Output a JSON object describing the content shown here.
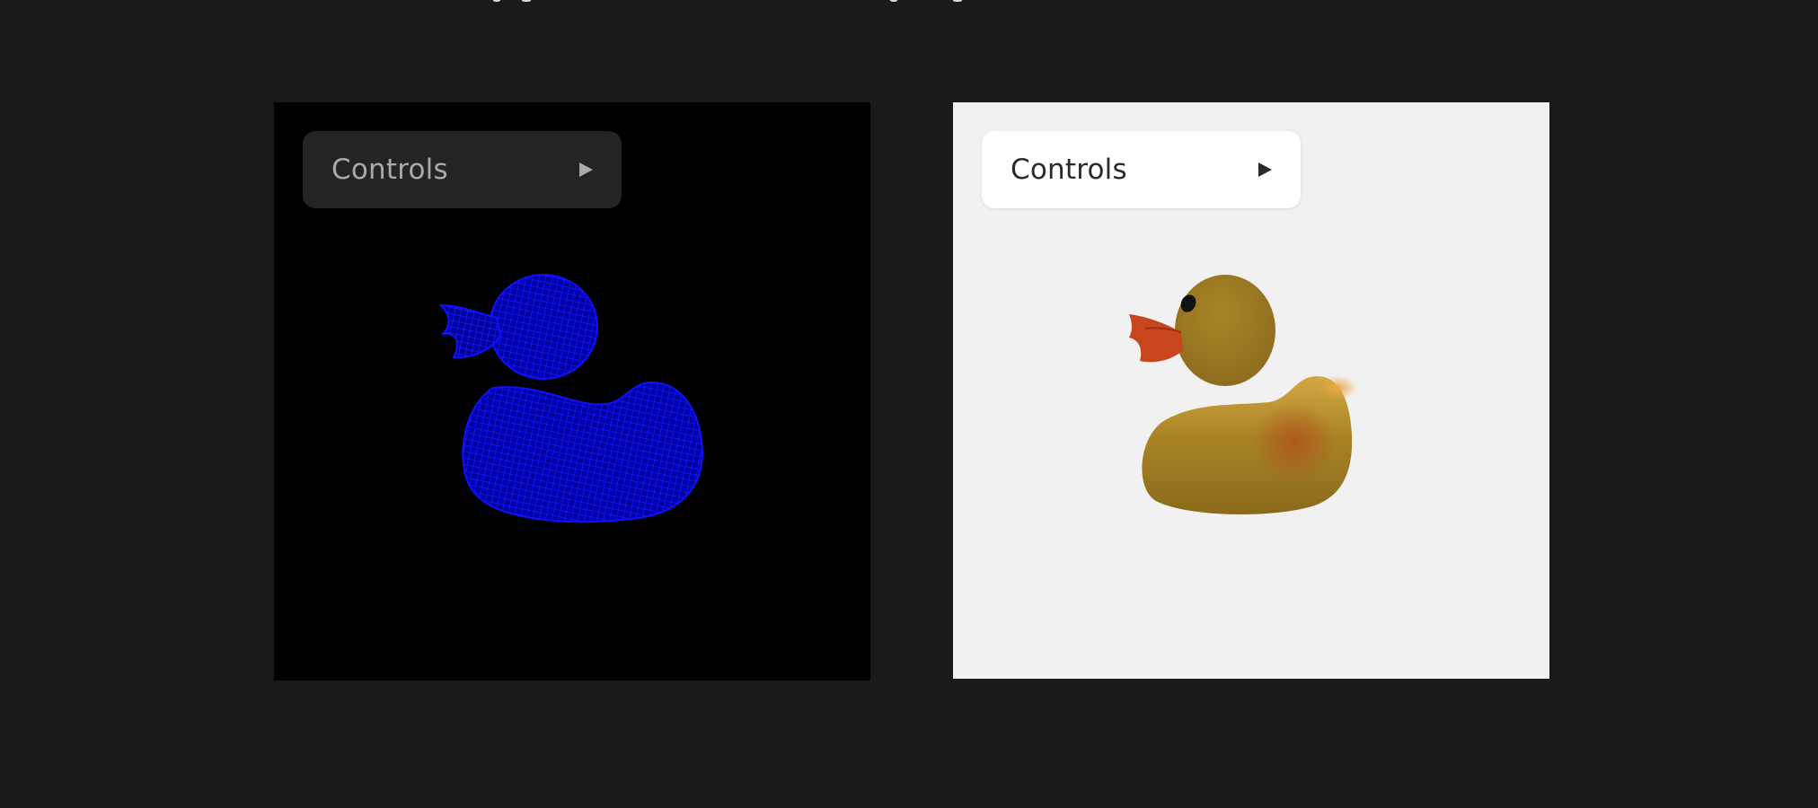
{
  "viewers": [
    {
      "theme": "dark",
      "render_mode": "wireframe",
      "model": "rubber-duck",
      "mesh_color": "#0000ff",
      "background": "#000000",
      "controls": {
        "label": "Controls",
        "icon": "play-triangle-icon",
        "expanded": false
      }
    },
    {
      "theme": "light",
      "render_mode": "shaded",
      "model": "rubber-duck",
      "body_color": "#a07b23",
      "beak_color": "#c8451d",
      "background": "#f1f1f1",
      "controls": {
        "label": "Controls",
        "icon": "play-triangle-icon",
        "expanded": false
      }
    }
  ]
}
